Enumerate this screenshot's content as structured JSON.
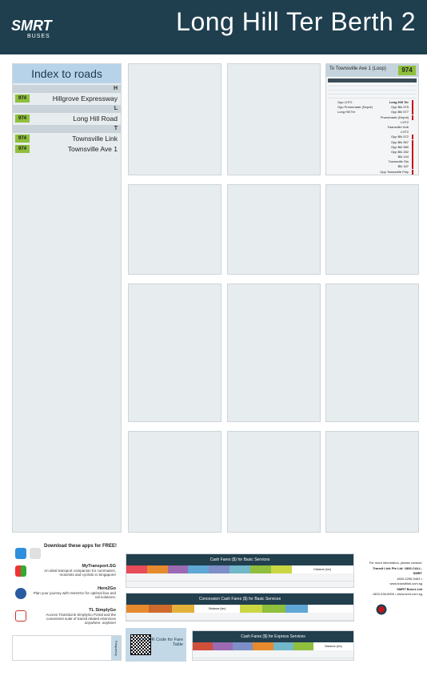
{
  "header": {
    "title": "Long Hill Ter Berth 2",
    "brand": "SMRT",
    "brand_sub": "BUSES"
  },
  "index": {
    "title": "Index to roads",
    "groups": [
      {
        "letter": "H",
        "roads": [
          {
            "name": "Hillgrove Expressway",
            "service": "974"
          }
        ]
      },
      {
        "letter": "L",
        "roads": [
          {
            "name": "Long Hill Road",
            "service": "974"
          }
        ]
      },
      {
        "letter": "T",
        "roads": [
          {
            "name": "Townsville Link",
            "service": "974"
          },
          {
            "name": "Townsville Ave 1",
            "service": "974"
          }
        ]
      }
    ]
  },
  "service_card": {
    "number": "974",
    "direction": "To Townsville Ave 1 (Loop)",
    "stops": [
      "Long Hill Ter",
      "Opp Blk 575",
      "Opp Blk 577",
      "Promenade (Depot)",
      "LHT2",
      "Townsville Hub",
      "LHT2",
      "Opp Blk 572",
      "Opp Blk 567",
      "Opp Blk 580",
      "Opp Blk 282",
      "Blk 144",
      "Townsville Stn",
      "Blk 187",
      "Opp Townsville Poly"
    ],
    "side_stops": [
      "Opp LHT2",
      "Opp Promenade (Depot)",
      "Long Hill Ter"
    ]
  },
  "apps": {
    "title": "Download these apps for FREE!",
    "items": [
      {
        "name": "MyTransport.SG",
        "desc": "An ideal transport companion for commuters, motorists and cyclists in Singapore!"
      },
      {
        "name": "Here2Go",
        "desc": "Plan your journey with Here2Go for optimal bus and rail solutions."
      },
      {
        "name": "TL SimplyGo",
        "desc": "Access TransitLink SimplyGo Portal and the convenient suite of transit related eServices anywhere, anytime!"
      }
    ],
    "store_labels": [
      "App Store",
      "Play Store"
    ]
  },
  "fares": {
    "basic_title": "Cash Fares ($) for Basic Services",
    "concession_title": "Concession Cash Fares ($) for Basic Services",
    "express_title": "Cash Fares ($) for Express Services",
    "distance_label": "Distance (km)"
  },
  "contact": {
    "lead": "For more information, please contact:",
    "lines": [
      "Transit Link Pte Ltd: 1800-CALL-SMRT",
      "1800-2255-5463 • www.transitlink.com.sg",
      "SMRT Buses Ltd",
      "1800-336-8900 • www.smrt.com.sg"
    ]
  },
  "qr": {
    "text": "Scan QR Code for Fare Table"
  },
  "frequency": {
    "tab": "Frequency"
  },
  "colors": {
    "header": "#1f3f4f",
    "service_badge": "#8fbf3c",
    "index_title": "#b7d3ea",
    "stop_marker": "#c4141b"
  }
}
